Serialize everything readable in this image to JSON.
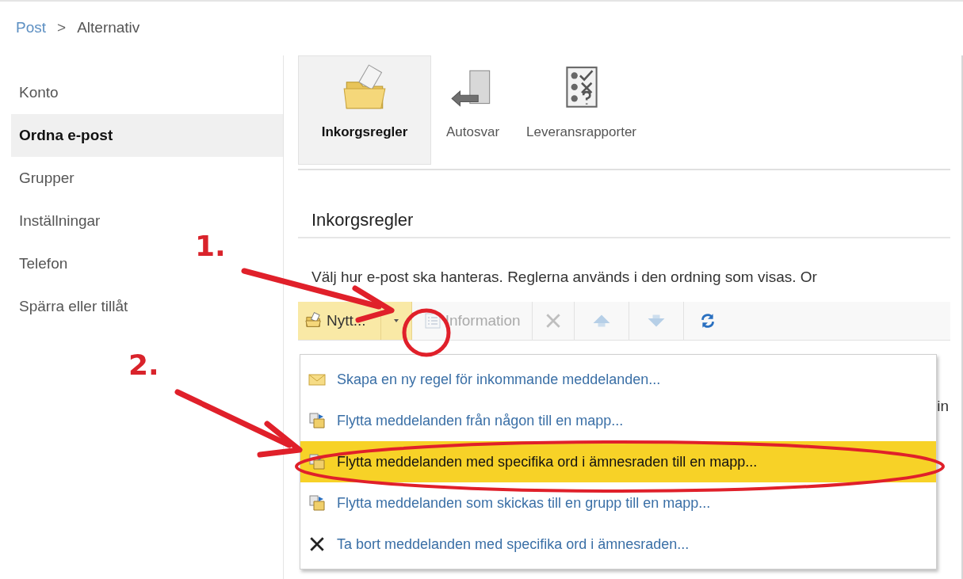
{
  "breadcrumb": {
    "link": "Post",
    "separator": ">",
    "current": "Alternativ"
  },
  "sidebar": {
    "items": [
      {
        "label": "Konto",
        "selected": false
      },
      {
        "label": "Ordna e-post",
        "selected": true
      },
      {
        "label": "Grupper",
        "selected": false
      },
      {
        "label": "Inställningar",
        "selected": false
      },
      {
        "label": "Telefon",
        "selected": false
      },
      {
        "label": "Spärra eller tillåt",
        "selected": false
      }
    ]
  },
  "ribbon": {
    "buttons": [
      {
        "label": "Inkorgsregler",
        "kind": "folder",
        "selected": true
      },
      {
        "label": "Autosvar",
        "kind": "reply",
        "selected": false
      },
      {
        "label": "Leveransrapporter",
        "kind": "checklist",
        "selected": false
      }
    ]
  },
  "section": {
    "title": "Inkorgsregler",
    "description": "Välj hur e-post ska hanteras. Reglerna används i den ordning som visas. Or"
  },
  "toolbar": {
    "buttons": [
      {
        "kind": "new",
        "label": "Nytt...",
        "highlighted": true,
        "disabled": false
      },
      {
        "kind": "caret",
        "highlighted": true,
        "disabled": false
      },
      {
        "kind": "details",
        "label": "Information",
        "highlighted": false,
        "disabled": true
      },
      {
        "kind": "delete",
        "highlighted": false,
        "disabled": true
      },
      {
        "kind": "up",
        "highlighted": false,
        "disabled": true
      },
      {
        "kind": "down",
        "highlighted": false,
        "disabled": true
      },
      {
        "kind": "refresh",
        "highlighted": false,
        "disabled": false
      }
    ]
  },
  "menu": {
    "items": [
      {
        "label": "Skapa en ny regel för inkommande meddelanden...",
        "kind": "envelope",
        "selected": false
      },
      {
        "label": "Flytta meddelanden från någon till en mapp...",
        "kind": "move",
        "selected": false
      },
      {
        "label": "Flytta meddelanden med specifika ord i ämnesraden till en mapp...",
        "kind": "move",
        "selected": true
      },
      {
        "label": "Flytta meddelanden som skickas till en grupp till en mapp...",
        "kind": "move",
        "selected": false
      },
      {
        "label": "Ta bort meddelanden med specifika ord i ämnesraden...",
        "kind": "delete",
        "selected": false
      }
    ]
  },
  "background_text": "in",
  "annotations": [
    {
      "label": "1."
    },
    {
      "label": "2."
    }
  ]
}
